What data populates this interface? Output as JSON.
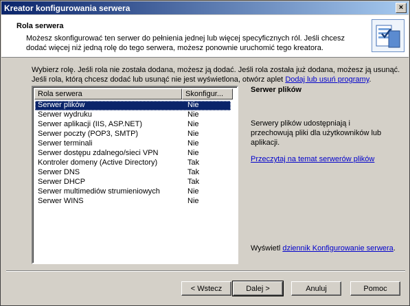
{
  "window": {
    "title": "Kreator konfigurowania serwera",
    "close": "×"
  },
  "header": {
    "title": "Rola serwera",
    "description": "Możesz skonfigurować ten serwer do pełnienia jednej lub więcej specyficznych ról. Jeśli chcesz dodać więcej niż jedną rolę do tego serwera, możesz ponownie uruchomić tego kreatora."
  },
  "instructions": {
    "text": "Wybierz rolę. Jeśli rola nie została dodana, możesz ją dodać. Jeśli rola została już dodana, możesz ją usunąć. Jeśli rola, którą chcesz dodać lub usunąć nie jest wyświetlona, otwórz aplet",
    "link": "Dodaj lub usuń programy",
    "suffix": "."
  },
  "roles_table": {
    "columns": [
      "Rola serwera",
      "Skonfigur..."
    ],
    "rows": [
      {
        "role": "Serwer plików",
        "configured": "Nie"
      },
      {
        "role": "Serwer wydruku",
        "configured": "Nie"
      },
      {
        "role": "Serwer aplikacji (IIS, ASP.NET)",
        "configured": "Nie"
      },
      {
        "role": "Serwer poczty (POP3, SMTP)",
        "configured": "Nie"
      },
      {
        "role": "Serwer terminali",
        "configured": "Nie"
      },
      {
        "role": "Serwer dostępu zdalnego/sieci VPN",
        "configured": "Nie"
      },
      {
        "role": "Kontroler domeny (Active Directory)",
        "configured": "Tak"
      },
      {
        "role": "Serwer DNS",
        "configured": "Tak"
      },
      {
        "role": "Serwer DHCP",
        "configured": "Tak"
      },
      {
        "role": "Serwer multimediów strumieniowych",
        "configured": "Nie"
      },
      {
        "role": "Serwer WINS",
        "configured": "Nie"
      }
    ],
    "selected_index": 0
  },
  "detail": {
    "title": "Serwer plików",
    "description": "Serwery plików udostępniają i przechowują pliki dla użytkowników lub aplikacji.",
    "link": "Przeczytaj na temat serwerów plików"
  },
  "log": {
    "prefix": "Wyświetl",
    "link": "dziennik Konfigurowanie serwera",
    "suffix": "."
  },
  "buttons": {
    "back": "< Wstecz",
    "next": "Dalej >",
    "cancel": "Anuluj",
    "help": "Pomoc"
  }
}
